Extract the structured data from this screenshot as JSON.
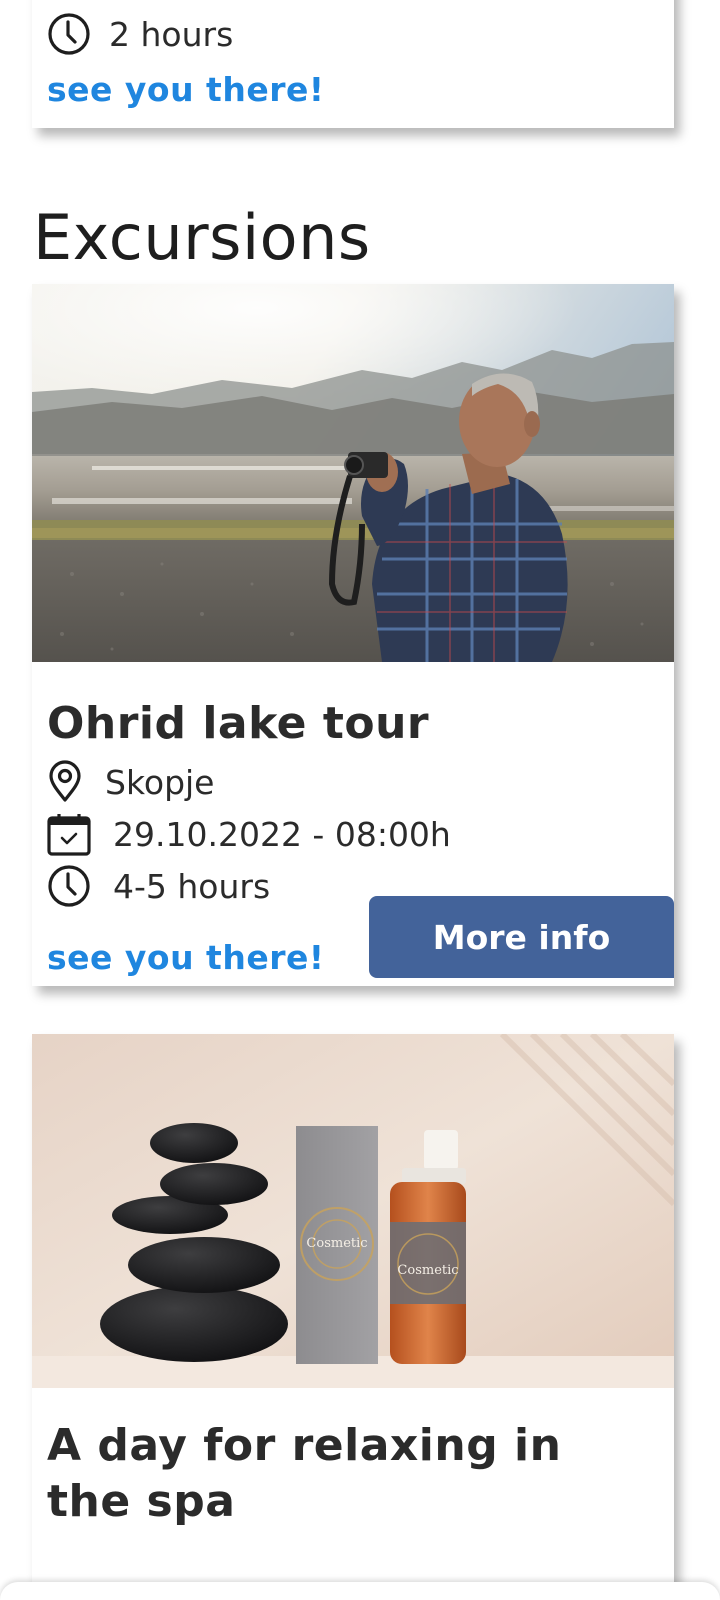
{
  "previous_event": {
    "duration": "2 hours",
    "rsvp_label": "see you there!"
  },
  "section": {
    "heading": "Excursions"
  },
  "excursion": {
    "title": "Ohrid lake tour",
    "location": "Skopje",
    "datetime": "29.10.2022 - 08:00h",
    "duration": "4-5 hours",
    "rsvp_label": "see you there!",
    "more_info_label": "More info"
  },
  "spa": {
    "title": "A day for relaxing in the spa",
    "product_brand": "Cosmetic"
  },
  "colors": {
    "accent_link": "#1f86df",
    "button_bg": "#43639a",
    "text": "#2b2b2b"
  },
  "icons": {
    "location": "location-pin-icon",
    "date": "calendar-icon",
    "duration": "clock-icon"
  }
}
